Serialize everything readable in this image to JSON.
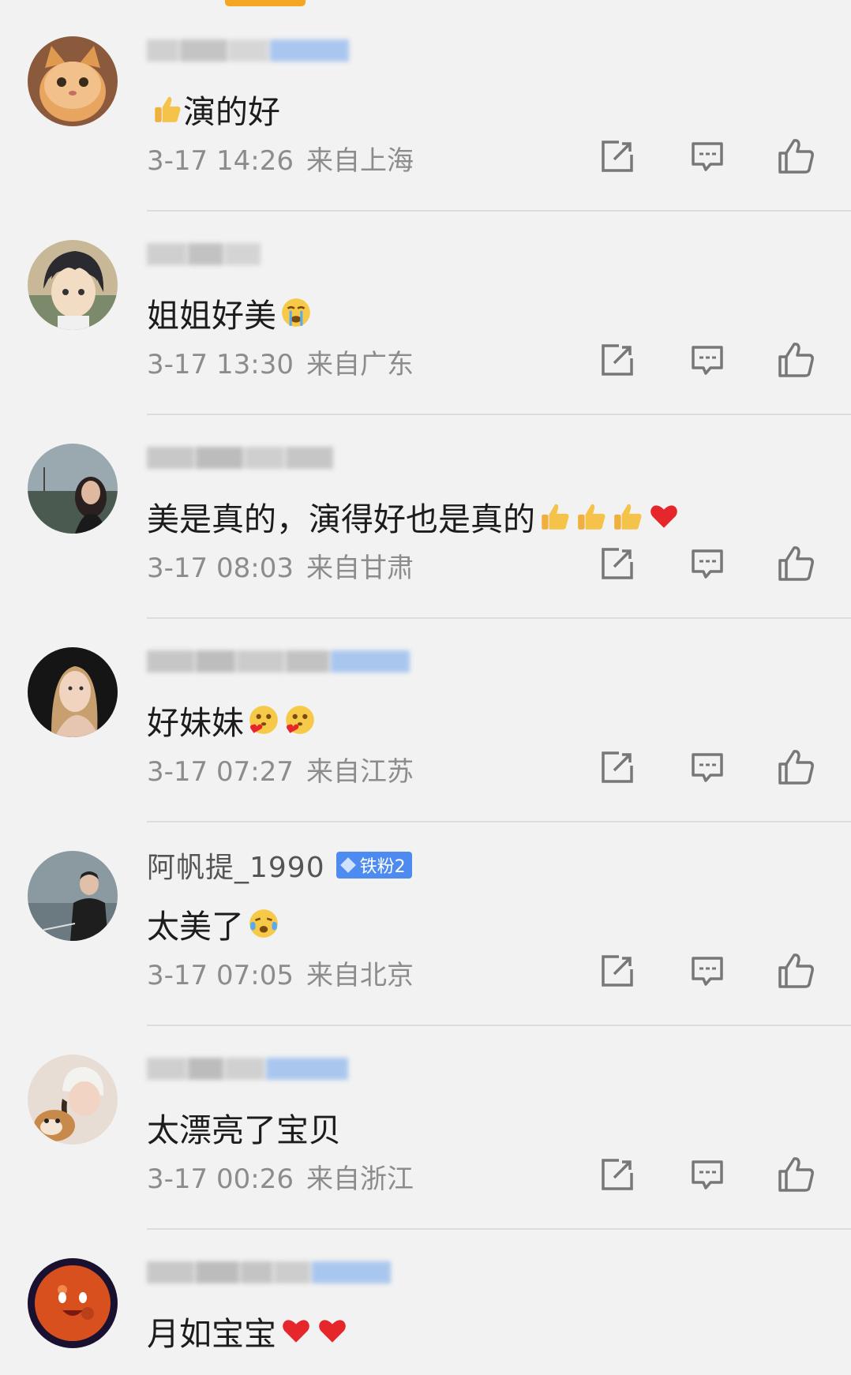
{
  "comments": [
    {
      "username": "",
      "badge": "",
      "text": "演的好",
      "time": "3-17 14:26",
      "location": "来自上海",
      "emoji_before": [
        "thumbs-up"
      ],
      "emoji_after": []
    },
    {
      "username": "",
      "badge": "",
      "text": "姐姐好美",
      "time": "3-17 13:30",
      "location": "来自广东",
      "emoji_before": [],
      "emoji_after": [
        "crying-face"
      ]
    },
    {
      "username": "",
      "badge": "",
      "text": "美是真的，演得好也是真的",
      "time": "3-17 08:03",
      "location": "来自甘肃",
      "emoji_before": [],
      "emoji_after": [
        "thumbs-up",
        "thumbs-up",
        "thumbs-up",
        "red-heart"
      ]
    },
    {
      "username": "",
      "badge": "",
      "text": "好妹妹",
      "time": "3-17 07:27",
      "location": "来自江苏",
      "emoji_before": [],
      "emoji_after": [
        "hugging-face",
        "hugging-face"
      ]
    },
    {
      "username": "阿帆提_1990",
      "badge": "铁粉2",
      "text": "太美了",
      "time": "3-17 07:05",
      "location": "来自北京",
      "emoji_before": [],
      "emoji_after": [
        "moved-face"
      ]
    },
    {
      "username": "",
      "badge": "",
      "text": "太漂亮了宝贝",
      "time": "3-17 00:26",
      "location": "来自浙江",
      "emoji_before": [],
      "emoji_after": []
    },
    {
      "username": "",
      "badge": "",
      "text": "月如宝宝",
      "time": "",
      "location": "",
      "emoji_before": [],
      "emoji_after": [
        "red-heart",
        "red-heart"
      ]
    }
  ],
  "icons": {
    "share": "share-icon",
    "reply": "comment-icon",
    "like": "thumbs-up-icon"
  },
  "colors": {
    "accent": "#f5a623",
    "badge": "#4d8bf0",
    "meta_text": "#8c8c8c"
  }
}
